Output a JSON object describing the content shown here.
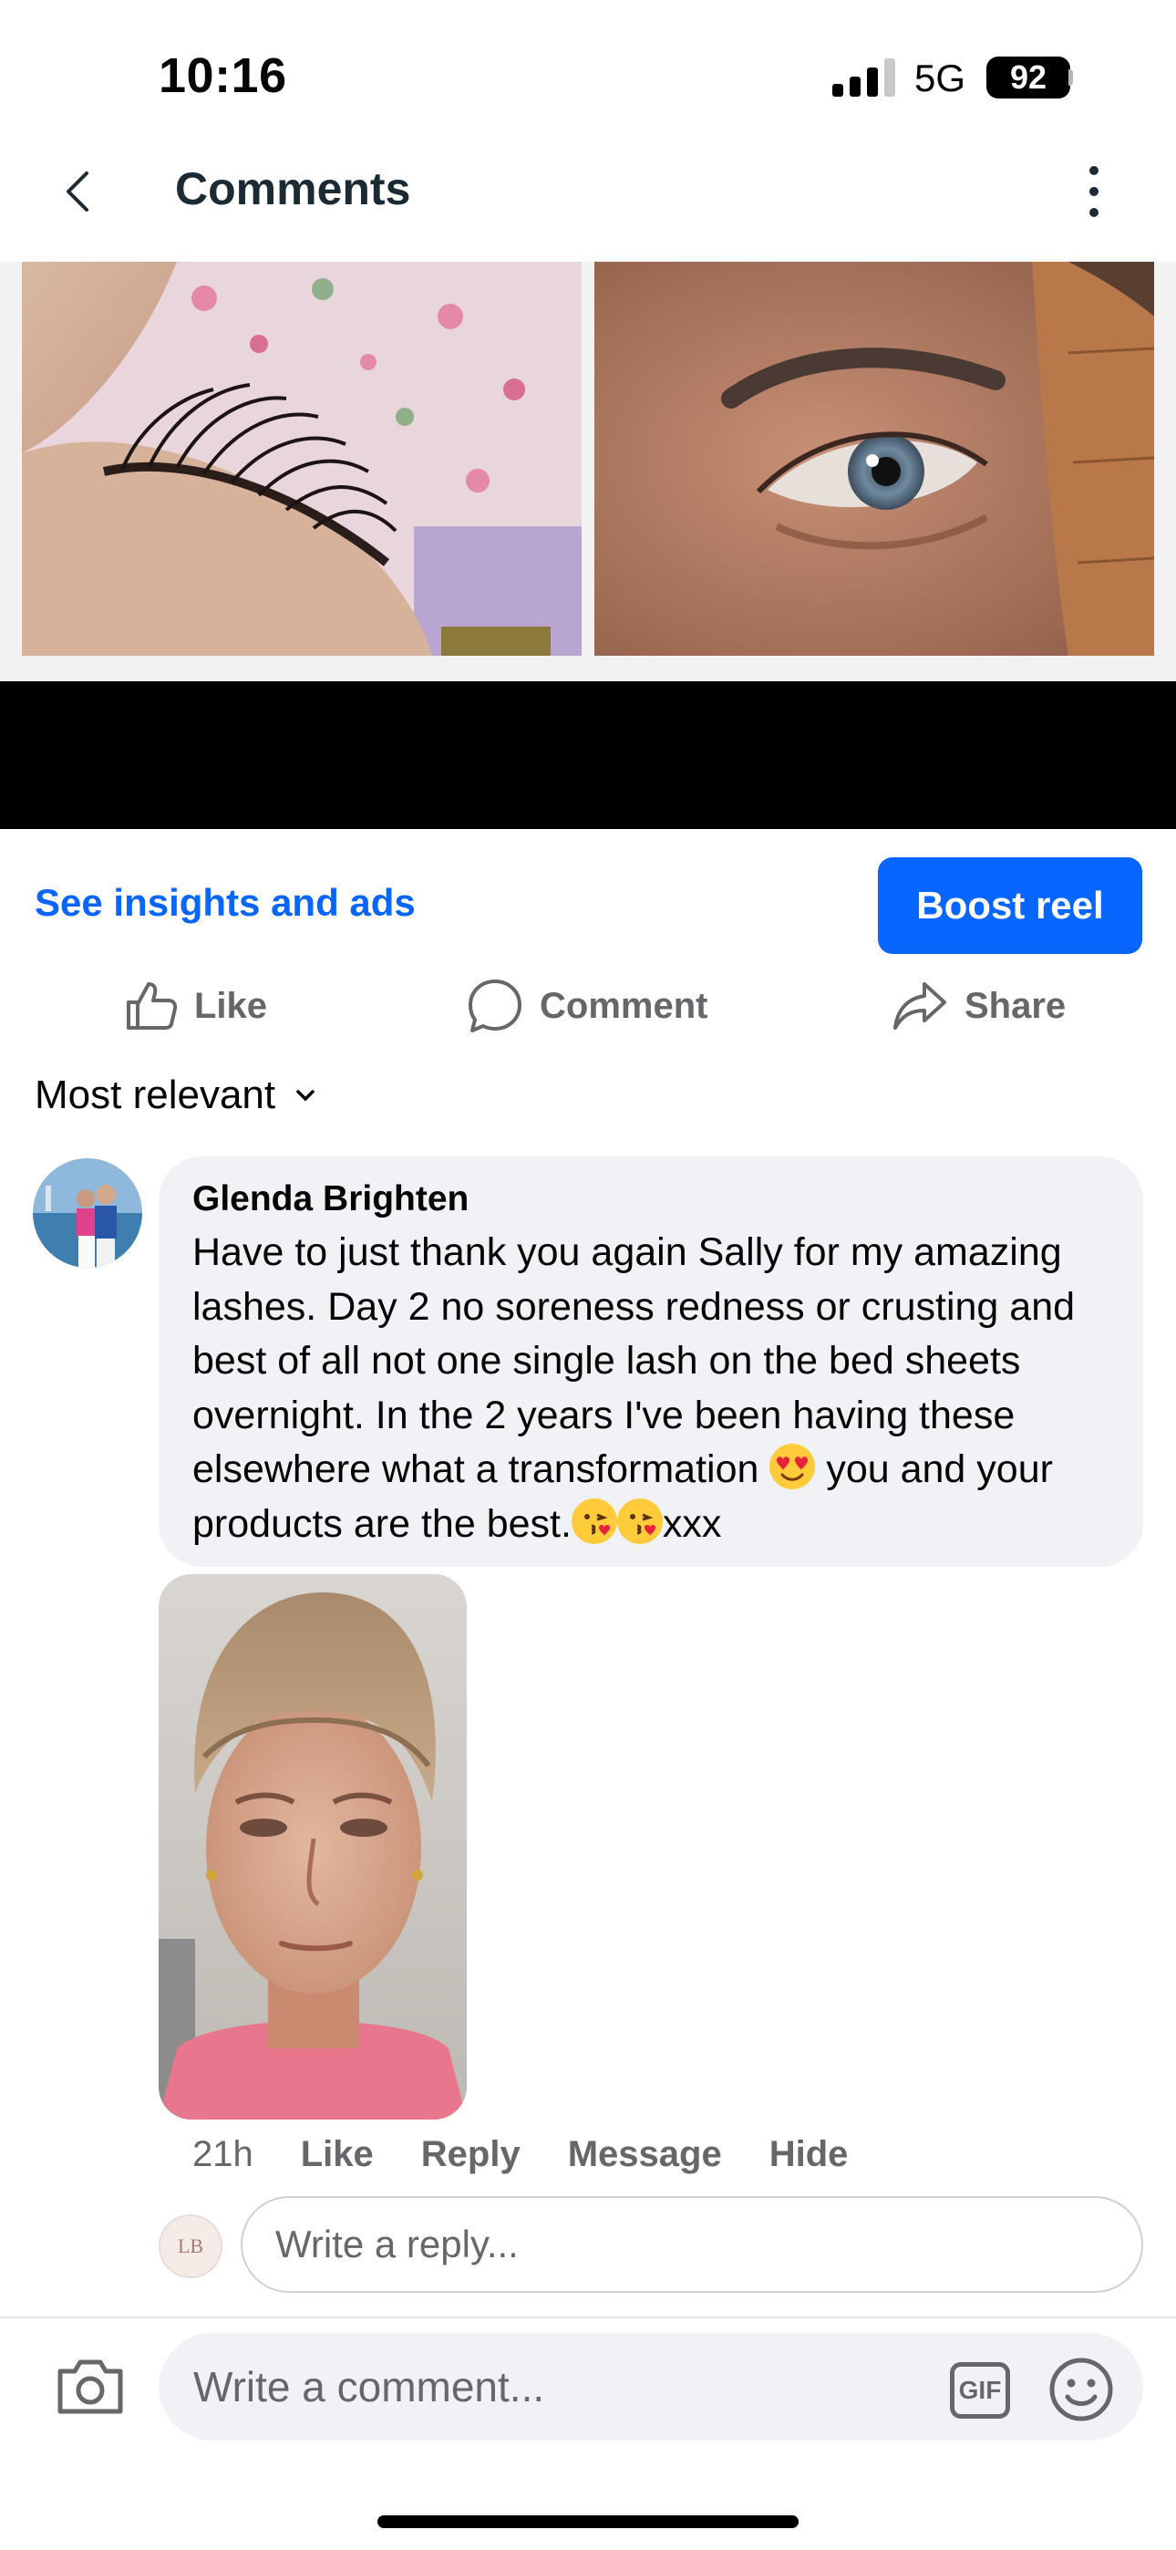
{
  "status_bar": {
    "time": "10:16",
    "network": "5G",
    "battery": "92"
  },
  "header": {
    "title": "Comments"
  },
  "post": {
    "insights_label": "See insights and ads",
    "boost_label": "Boost reel",
    "actions": {
      "like": "Like",
      "comment": "Comment",
      "share": "Share"
    }
  },
  "sort": {
    "label": "Most relevant"
  },
  "comment": {
    "author": "Glenda Brighten",
    "text_part1": "Have to just thank you again Sally for my amazing lashes. Day 2 no soreness redness or crusting and best of all not one single lash on the bed sheets overnight. In the 2 years I've been having these elsewhere what a transformation ",
    "text_part2": " you and your products are the best.",
    "text_part3": "xxx",
    "time": "21h",
    "like": "Like",
    "reply": "Reply",
    "message": "Message",
    "hide": "Hide"
  },
  "reply_box": {
    "avatar_initials": "LB",
    "placeholder": "Write a reply..."
  },
  "composer": {
    "placeholder": "Write a comment...",
    "gif_label": "GIF"
  },
  "colors": {
    "accent": "#0866ff",
    "secondary_text": "#65676b",
    "bubble": "#f0f2f5"
  }
}
